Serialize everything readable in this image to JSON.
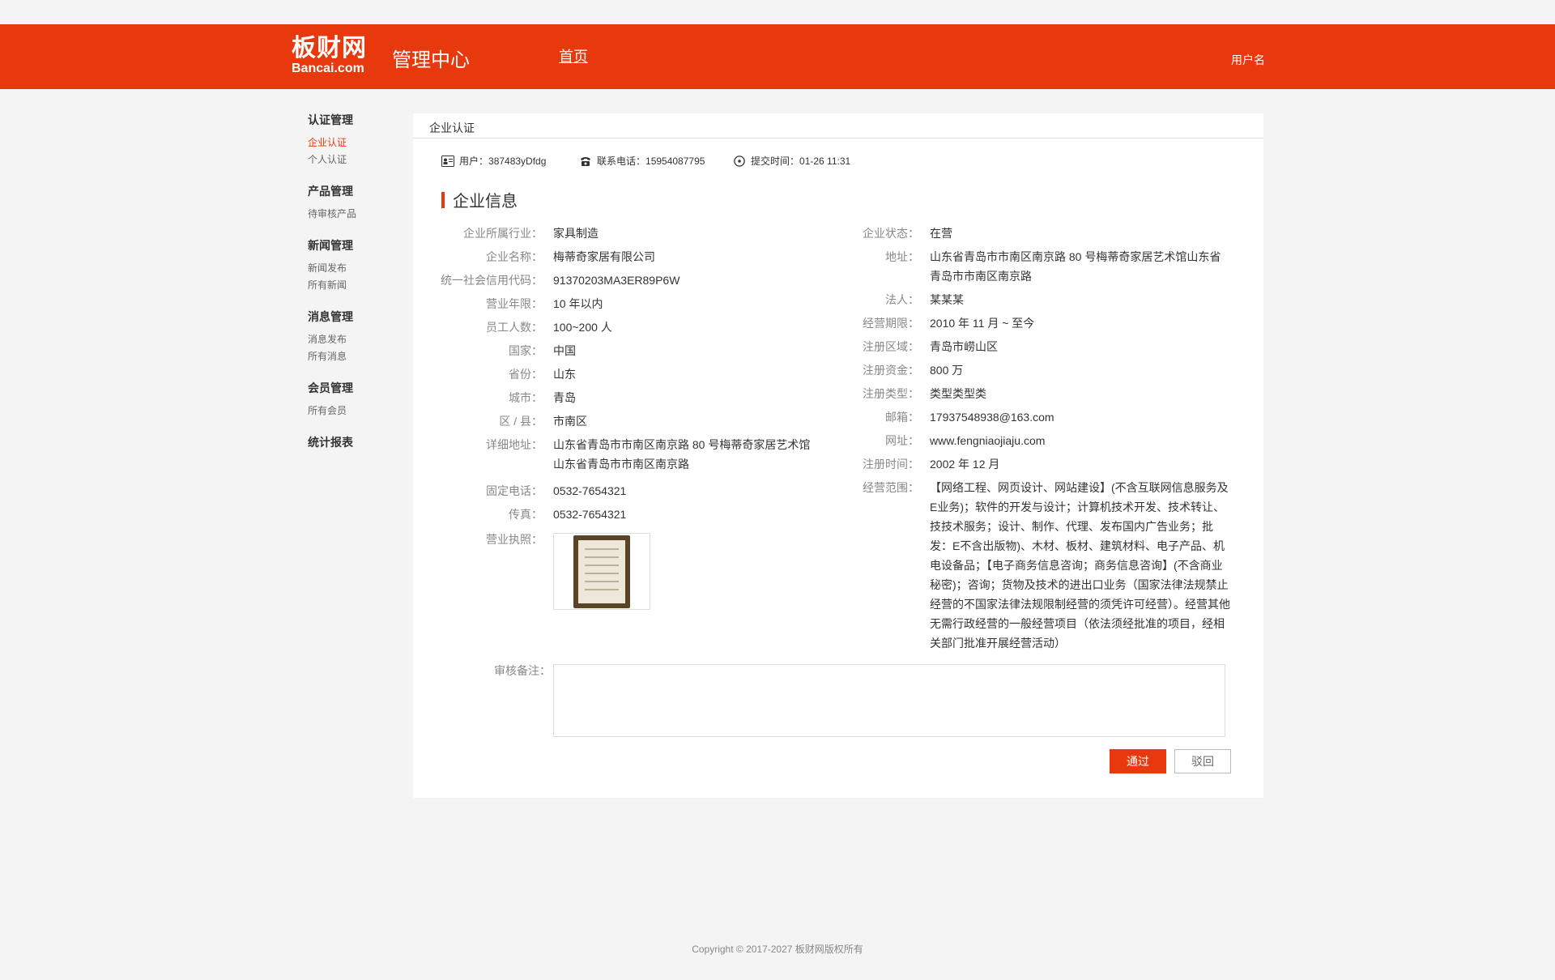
{
  "header": {
    "logo_cn": "板财网",
    "logo_en": "Bancai.com",
    "title": "管理中心",
    "nav_home": "首页",
    "username": "用户名"
  },
  "sidebar": {
    "groups": [
      {
        "title": "认证管理",
        "items": [
          "企业认证",
          "个人认证"
        ]
      },
      {
        "title": "产品管理",
        "items": [
          "待审核产品"
        ]
      },
      {
        "title": "新闻管理",
        "items": [
          "新闻发布",
          "所有新闻"
        ]
      },
      {
        "title": "消息管理",
        "items": [
          "消息发布",
          "所有消息"
        ]
      },
      {
        "title": "会员管理",
        "items": [
          "所有会员"
        ]
      },
      {
        "title": "统计报表",
        "items": []
      }
    ],
    "active_item": "企业认证"
  },
  "panel": {
    "tab": "企业认证",
    "user_label": "用户：",
    "user_value": "387483yDfdg",
    "phone_label": "联系电话：",
    "phone_value": "15954087795",
    "time_label": "提交时间：",
    "time_value": "01-26  11:31",
    "section_title": "企业信息"
  },
  "left_fields": [
    {
      "label": "企业所属行业：",
      "value": "家具制造"
    },
    {
      "label": "企业名称：",
      "value": "梅蒂奇家居有限公司"
    },
    {
      "label": "统一社会信用代码：",
      "value": "91370203MA3ER89P6W"
    },
    {
      "label": "营业年限：",
      "value": "10 年以内"
    },
    {
      "label": "员工人数：",
      "value": "100~200 人"
    },
    {
      "label": "国家：",
      "value": "中国"
    },
    {
      "label": "省份：",
      "value": "山东"
    },
    {
      "label": "城市：",
      "value": "青岛"
    },
    {
      "label": "区 / 县：",
      "value": "市南区"
    },
    {
      "label": "详细地址：",
      "value": "山东省青岛市市南区南京路 80 号梅蒂奇家居艺术馆山东省青岛市市南区南京路"
    },
    {
      "label": "固定电话：",
      "value": "0532-7654321"
    },
    {
      "label": "传真：",
      "value": "0532-7654321"
    },
    {
      "label": "营业执照：",
      "value": ""
    }
  ],
  "right_fields": [
    {
      "label": "企业状态：",
      "value": "在营"
    },
    {
      "label": "地址：",
      "value": "山东省青岛市市南区南京路 80 号梅蒂奇家居艺术馆山东省青岛市市南区南京路"
    },
    {
      "label": "法人：",
      "value": "某某某"
    },
    {
      "label": "经营期限：",
      "value": "2010 年 11 月 ~ 至今"
    },
    {
      "label": "注册区域：",
      "value": "青岛市崂山区"
    },
    {
      "label": "注册资金：",
      "value": "800 万"
    },
    {
      "label": "注册类型：",
      "value": "类型类型类"
    },
    {
      "label": "邮箱：",
      "value": "17937548938@163.com"
    },
    {
      "label": "网址：",
      "value": "www.fengniaojiaju.com"
    },
    {
      "label": "注册时间：",
      "value": "2002 年 12 月"
    },
    {
      "label": "经营范围：",
      "value": "【网络工程、网页设计、网站建设】(不含互联网信息服务及E业务)；软件的开发与设计；计算机技术开发、技术转让、技技术服务；设计、制作、代理、发布国内广告业务；批发：E不含出版物)、木材、板材、建筑材料、电子产品、机电设备品；【电子商务信息咨询；商务信息咨询】(不含商业秘密)；咨询；货物及技术的进出口业务（国家法律法规禁止经营的不国家法律法规限制经营的须凭许可经营）。经营其他无需行政经营的一般经营项目（依法须经批准的项目，经相关部门批准开展经营活动）"
    }
  ],
  "review": {
    "label": "审核备注：",
    "placeholder": "",
    "pass_button": "通过",
    "reject_button": "驳回"
  },
  "footer": "Copyright © 2017-2027  板财网版权所有",
  "colors": {
    "brand": "#e8380d",
    "label": "#888888",
    "text": "#333333",
    "border": "#dddddd"
  }
}
